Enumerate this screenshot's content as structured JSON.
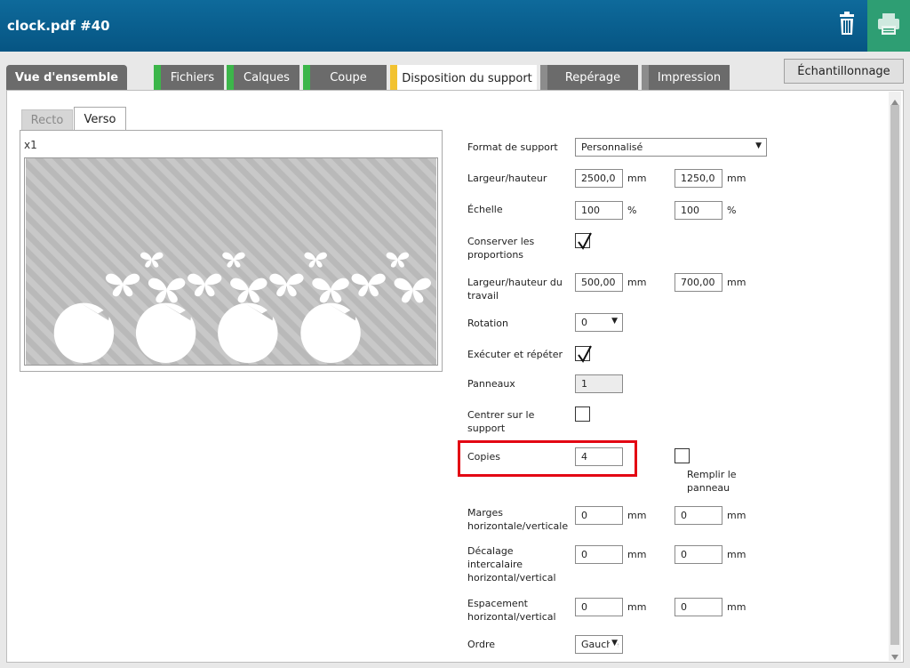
{
  "header": {
    "title": "clock.pdf #40",
    "trash_icon": "trash-icon",
    "print_icon": "printer-icon"
  },
  "colors": {
    "header": "#065583",
    "print": "#2e9e73",
    "tab_inactive": "#6b6b6b",
    "strip_green": "#3cb64a",
    "strip_yellow": "#f2c230",
    "highlight": "#e30613"
  },
  "tabs": [
    {
      "label": "Vue d'ensemble"
    },
    {
      "label": "Fichiers"
    },
    {
      "label": "Calques"
    },
    {
      "label": "Coupe"
    },
    {
      "label": "Disposition du support"
    },
    {
      "label": "Repérage"
    },
    {
      "label": "Impression"
    }
  ],
  "sampling_button": "Échantillonnage",
  "subtabs": {
    "recto": "Recto",
    "verso": "Verso"
  },
  "preview": {
    "count_label": "x1"
  },
  "form": {
    "media_format": {
      "label": "Format de support",
      "value": "Personnalisé"
    },
    "width_height": {
      "label": "Largeur/hauteur",
      "width": "2500,0",
      "height": "1250,0",
      "unit": "mm"
    },
    "scale": {
      "label": "Échelle",
      "x": "100",
      "y": "100",
      "unit": "%"
    },
    "keep_proportions": {
      "label": "Conserver les proportions",
      "checked": true
    },
    "job_size": {
      "label": "Largeur/hauteur du travail",
      "width": "500,00",
      "height": "700,00",
      "unit": "mm"
    },
    "rotation": {
      "label": "Rotation",
      "value": "0"
    },
    "step_repeat": {
      "label": "Exécuter et répéter",
      "checked": true
    },
    "panels": {
      "label": "Panneaux",
      "value": "1"
    },
    "center": {
      "label": "Centrer sur le support",
      "checked": false
    },
    "copies": {
      "label": "Copies",
      "value": "4"
    },
    "fill_panel": {
      "label": "Remplir le panneau",
      "checked": false
    },
    "margins": {
      "label": "Marges horizontale/verticale",
      "h": "0",
      "v": "0",
      "unit": "mm"
    },
    "offset": {
      "label": "Décalage intercalaire horizontal/vertical",
      "h": "0",
      "v": "0",
      "unit": "mm"
    },
    "spacing": {
      "label": "Espacement horizontal/vertical",
      "h": "0",
      "v": "0",
      "unit": "mm"
    },
    "order": {
      "label": "Ordre",
      "value": "Gauche"
    }
  }
}
